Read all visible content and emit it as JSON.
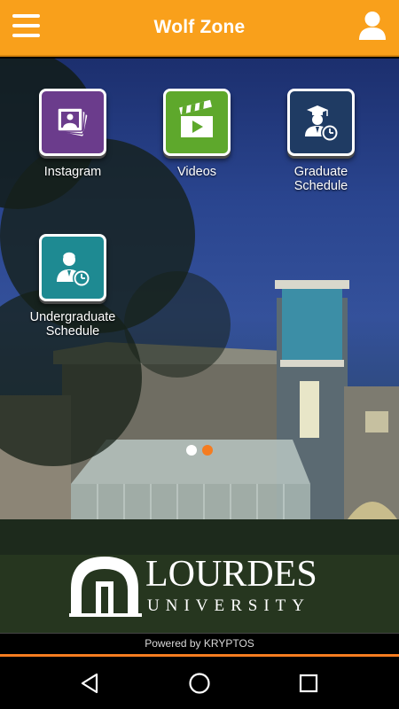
{
  "header": {
    "title": "Wolf Zone",
    "menu_icon": "menu-icon",
    "profile_icon": "user-icon"
  },
  "tiles": [
    {
      "label": "Instagram",
      "icon": "photos-icon",
      "color": "#6b3c8c"
    },
    {
      "label": "Videos",
      "icon": "clapperboard-icon",
      "color": "#5ea82c"
    },
    {
      "label": "Graduate\nSchedule",
      "icon": "graduate-clock-icon",
      "color": "#1f3b63"
    },
    {
      "label": "Undergraduate\nSchedule",
      "icon": "person-clock-icon",
      "color": "#1e8a92"
    }
  ],
  "pager": {
    "dots": 2,
    "active": 2,
    "active_color": "#f57c20",
    "inactive_color": "#ffffff"
  },
  "logo": {
    "name": "LOURDES",
    "subtitle": "UNIVERSITY"
  },
  "footer": {
    "powered_by": "Powered by KRYPTOS"
  },
  "system_nav": [
    "back-icon",
    "home-icon",
    "recents-icon"
  ],
  "colors": {
    "header": "#f9a01b",
    "accent": "#f57c20"
  }
}
